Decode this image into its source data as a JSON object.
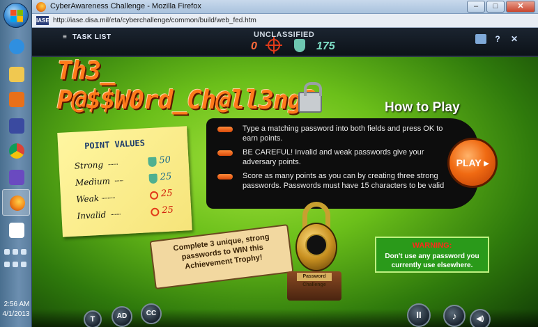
{
  "taskbar": {
    "clock_time": "2:56 AM",
    "clock_date": "4/1/2013",
    "pinned": [
      "windows-start",
      "internet-explorer",
      "file-explorer",
      "media-player",
      "stellarium",
      "chrome",
      "app-launcher",
      "firefox",
      "solitaire"
    ]
  },
  "window": {
    "title": "CyberAwareness Challenge - Mozilla Firefox",
    "minimize": "–",
    "maximize": "□",
    "close": "✕",
    "url": "http://iase.disa.mil/eta/cyberchallenge/common/build/web_fed.htm",
    "site_icon": "IASE"
  },
  "game": {
    "task_list": "TASK LIST",
    "classification": "UNCLASSIFIED",
    "score_adversary": "0",
    "score_player": "175",
    "title_line1": "Th3_",
    "title_line2": "P@$$W0rd_Ch@ll3ng3",
    "how_to_play": "How to Play",
    "instructions": [
      "Type a matching password into both fields and press OK to earn points.",
      "BE CAREFUL! Invalid and weak passwords give your adversary points.",
      "Score as many points as you can by creating three strong passwords. Passwords must have 15 characters to be valid"
    ],
    "play_label": "PLAY ▸",
    "point_values": {
      "title": "POINT VALUES",
      "rows": [
        {
          "label": "Strong",
          "dots": "........",
          "value": "50"
        },
        {
          "label": "Medium",
          "dots": ".......",
          "value": "25"
        },
        {
          "label": "Weak",
          "dots": "...........",
          "value": "25"
        },
        {
          "label": "Invalid",
          "dots": "........",
          "value": "25"
        }
      ]
    },
    "ribbon_text": "Complete 3 unique, strong passwords to WIN this Achievement Trophy!",
    "trophy_plate": "Password Challenge",
    "warning": {
      "title": "WARNING:",
      "text": "Don't use any password you currently use elsewhere."
    },
    "controls": {
      "transcript": "T",
      "audio_desc": "AD",
      "captions": "CC",
      "pause": "II",
      "music": "♪",
      "volume": "◀)"
    }
  }
}
